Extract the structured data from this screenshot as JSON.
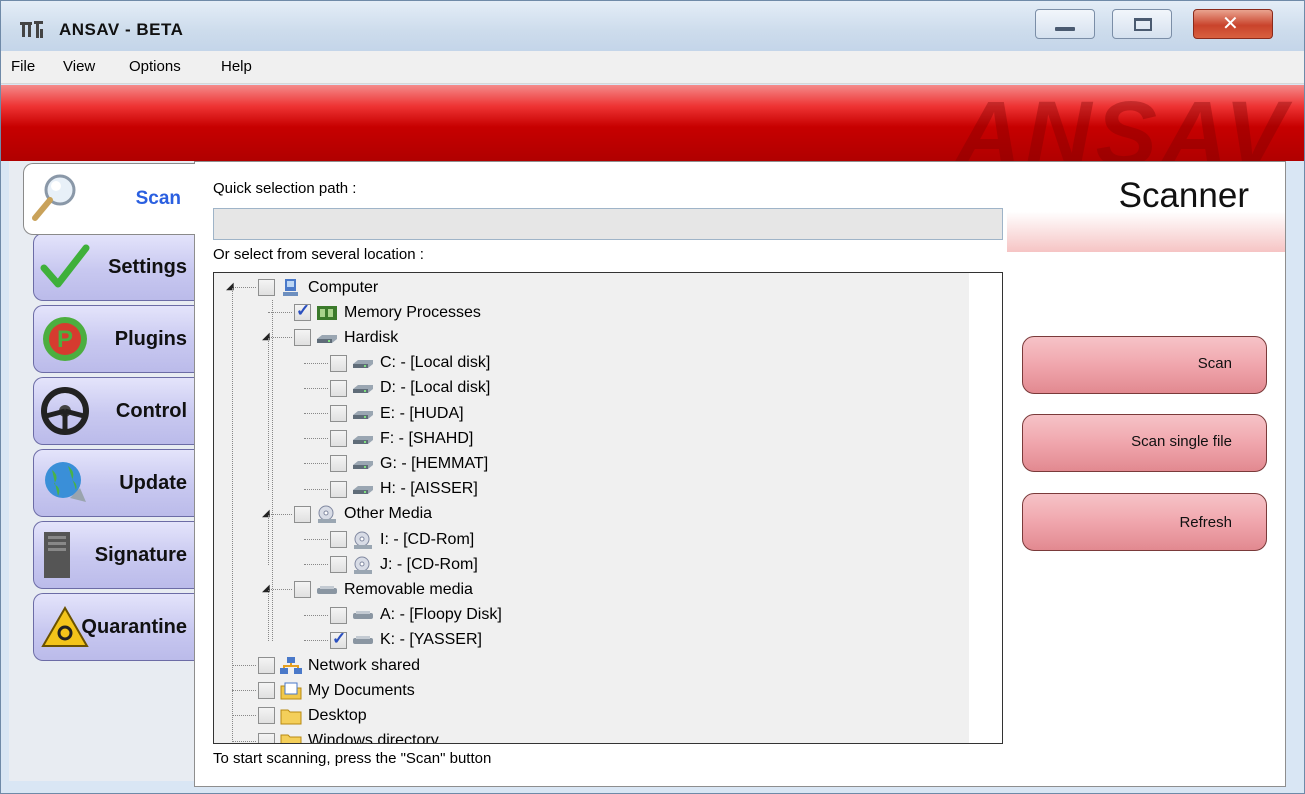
{
  "window": {
    "title": "ANSAV - BETA",
    "icon": "ansav-app-icon"
  },
  "menu": [
    "File",
    "View",
    "Options",
    "Help"
  ],
  "banner": {
    "logo_text": "ANSAV"
  },
  "tabs": [
    {
      "label": "Scan",
      "icon": "magnifier-icon",
      "active": true
    },
    {
      "label": "Settings",
      "icon": "checkmark-icon"
    },
    {
      "label": "Plugins",
      "icon": "plugin-p-icon"
    },
    {
      "label": "Control",
      "icon": "steering-wheel-icon"
    },
    {
      "label": "Update",
      "icon": "globe-icon"
    },
    {
      "label": "Signature",
      "icon": "database-icon"
    },
    {
      "label": "Quarantine",
      "icon": "biohazard-icon"
    }
  ],
  "scanner": {
    "title": "Scanner",
    "quick_path_label": "Quick selection path :",
    "quick_path_value": "",
    "locations_label": "Or select from several location :",
    "hint": "To start scanning, press the \"Scan\" button",
    "buttons": {
      "scan": "Scan",
      "scan_single": "Scan single file",
      "refresh": "Refresh"
    }
  },
  "tree": [
    {
      "label": "Computer",
      "checked": false,
      "icon": "computer-icon"
    },
    {
      "label": "Memory Processes",
      "checked": true,
      "icon": "memory-icon"
    },
    {
      "label": "Hardisk",
      "checked": false,
      "icon": "drive-icon"
    },
    {
      "label": "C: - [Local disk]",
      "checked": false,
      "icon": "drive-icon"
    },
    {
      "label": "D: - [Local disk]",
      "checked": false,
      "icon": "drive-icon"
    },
    {
      "label": "E: - [HUDA]",
      "checked": false,
      "icon": "drive-icon"
    },
    {
      "label": "F: - [SHAHD]",
      "checked": false,
      "icon": "drive-icon"
    },
    {
      "label": "G: - [HEMMAT]",
      "checked": false,
      "icon": "drive-icon"
    },
    {
      "label": "H: - [AISSER]",
      "checked": false,
      "icon": "drive-icon"
    },
    {
      "label": "Other Media",
      "checked": false,
      "icon": "cdrom-icon"
    },
    {
      "label": "I: - [CD-Rom]",
      "checked": false,
      "icon": "cdrom-icon"
    },
    {
      "label": "J: - [CD-Rom]",
      "checked": false,
      "icon": "cdrom-icon"
    },
    {
      "label": "Removable media",
      "checked": false,
      "icon": "removable-drive-icon"
    },
    {
      "label": "A: - [Floopy Disk]",
      "checked": false,
      "icon": "removable-drive-icon"
    },
    {
      "label": "K: - [YASSER]",
      "checked": true,
      "icon": "removable-drive-icon"
    },
    {
      "label": "Network shared",
      "checked": false,
      "icon": "network-icon"
    },
    {
      "label": "My Documents",
      "checked": false,
      "icon": "documents-folder-icon"
    },
    {
      "label": "Desktop",
      "checked": false,
      "icon": "folder-icon"
    },
    {
      "label": "Windows directory",
      "checked": false,
      "icon": "folder-icon"
    }
  ]
}
